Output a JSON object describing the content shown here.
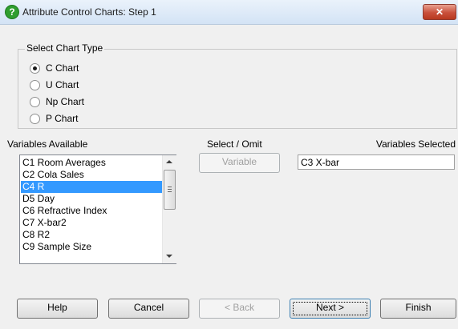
{
  "window": {
    "title": "Attribute Control Charts: Step 1",
    "close_label": "✕"
  },
  "chart_type": {
    "legend": "Select Chart Type",
    "options": [
      {
        "label": "C Chart",
        "selected": true
      },
      {
        "label": "U Chart",
        "selected": false
      },
      {
        "label": "Np Chart",
        "selected": false
      },
      {
        "label": "P Chart",
        "selected": false
      }
    ]
  },
  "variables_available": {
    "label": "Variables Available",
    "items": [
      {
        "label": "C1 Room Averages",
        "selected": false
      },
      {
        "label": "C2 Cola Sales",
        "selected": false
      },
      {
        "label": "C4 R",
        "selected": true
      },
      {
        "label": "D5 Day",
        "selected": false
      },
      {
        "label": "C6 Refractive Index",
        "selected": false
      },
      {
        "label": "C7 X-bar2",
        "selected": false
      },
      {
        "label": "C8 R2",
        "selected": false
      },
      {
        "label": "C9 Sample Size",
        "selected": false
      }
    ]
  },
  "select_omit": {
    "label": "Select / Omit",
    "variable_button": "Variable"
  },
  "variables_selected": {
    "label": "Variables Selected",
    "value": "C3 X-bar"
  },
  "buttons": {
    "help": "Help",
    "cancel": "Cancel",
    "back": "< Back",
    "next": "Next >",
    "finish": "Finish"
  }
}
